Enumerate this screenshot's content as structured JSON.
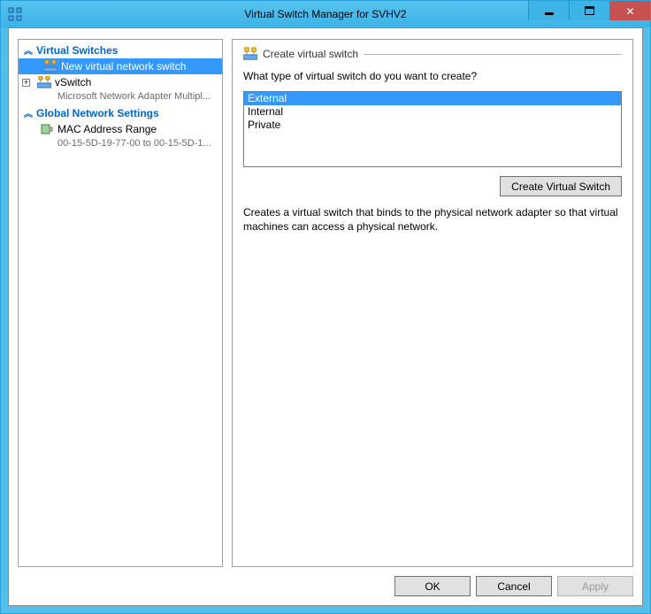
{
  "window": {
    "title": "Virtual Switch Manager for SVHV2"
  },
  "tree": {
    "section1": "Virtual Switches",
    "item_new": "New virtual network switch",
    "item_vswitch": "vSwitch",
    "item_vswitch_sub": "Microsoft Network Adapter Multipl...",
    "section2": "Global Network Settings",
    "item_mac": "MAC Address Range",
    "item_mac_sub": "00-15-5D-19-77-00 to 00-15-5D-1..."
  },
  "panel": {
    "group_title": "Create virtual switch",
    "prompt": "What type of virtual switch do you want to create?",
    "options": {
      "o1": "External",
      "o2": "Internal",
      "o3": "Private"
    },
    "create_btn": "Create Virtual Switch",
    "description": "Creates a virtual switch that binds to the physical network adapter so that virtual machines can access a physical network."
  },
  "footer": {
    "ok": "OK",
    "cancel": "Cancel",
    "apply": "Apply"
  }
}
